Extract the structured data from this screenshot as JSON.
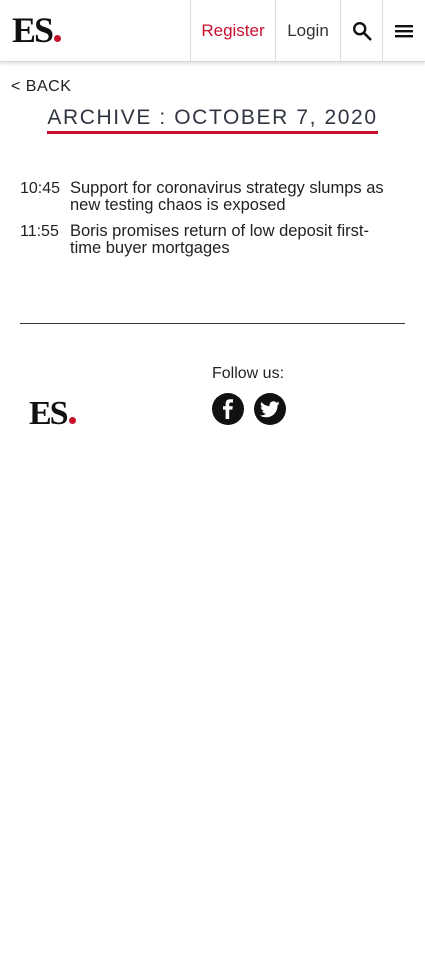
{
  "header": {
    "logo": "ES",
    "register_label": "Register",
    "login_label": "Login",
    "search_icon": "search-icon",
    "menu_icon": "hamburger-menu-icon"
  },
  "back_label": "< BACK",
  "archive_title": "ARCHIVE : OCTOBER 7, 2020",
  "articles": [
    {
      "time": "10:45",
      "headline": "Support for coronavirus strategy slumps as new testing chaos is exposed"
    },
    {
      "time": "11:55",
      "headline": "Boris promises return of low deposit first-time buyer mortgages"
    }
  ],
  "footer": {
    "logo": "ES",
    "follow_label": "Follow us:",
    "social_icons": [
      "facebook-icon",
      "twitter-icon"
    ]
  },
  "colors": {
    "brand_red": "#c8102e",
    "text": "#222222",
    "title_text": "#2f3541"
  }
}
